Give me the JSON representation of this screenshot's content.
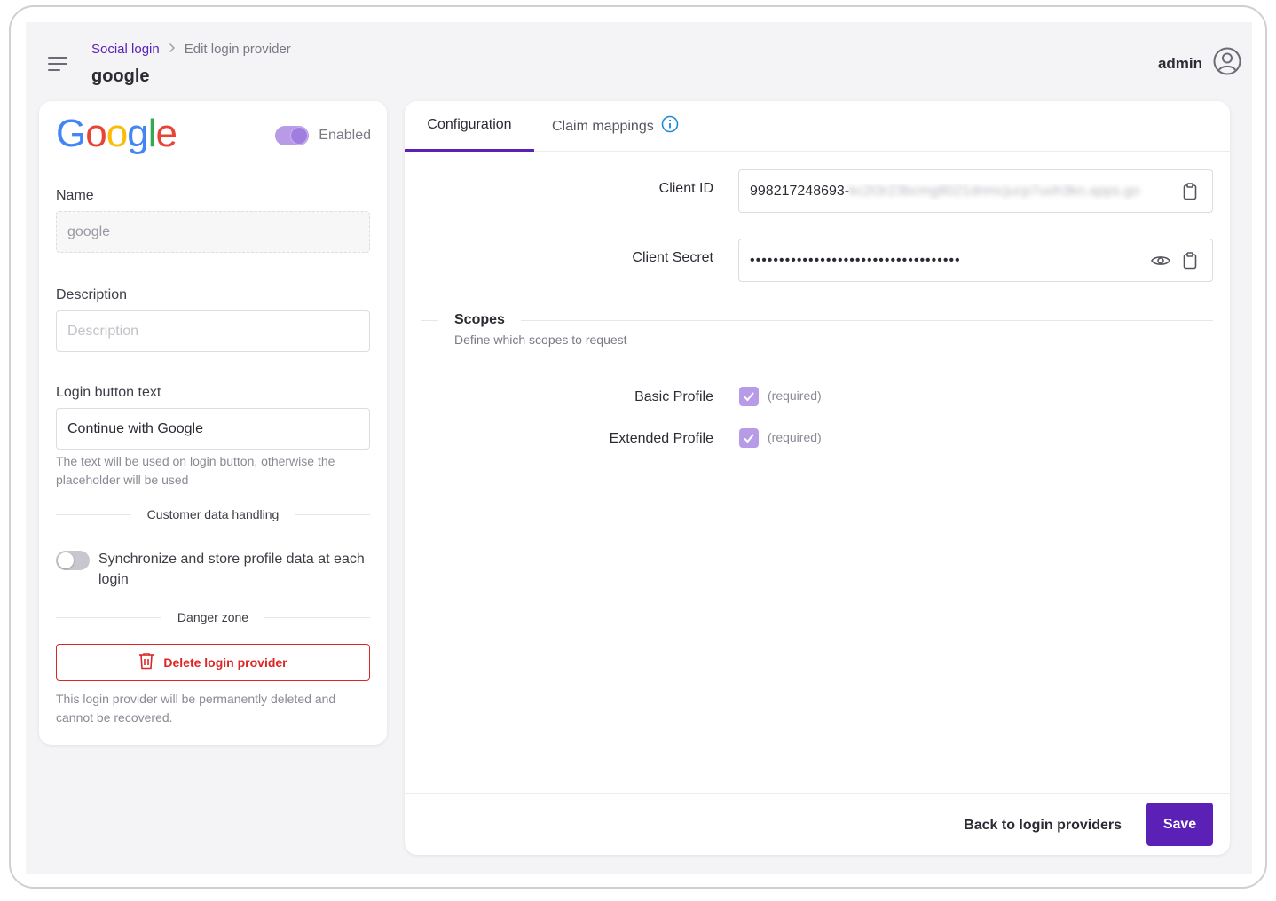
{
  "header": {
    "breadcrumb_link": "Social login",
    "breadcrumb_current": "Edit login provider",
    "page_title": "google",
    "user_name": "admin"
  },
  "provider": {
    "logo_letters": [
      "G",
      "o",
      "o",
      "g",
      "l",
      "e"
    ],
    "enabled_label": "Enabled",
    "enabled": true,
    "name_label": "Name",
    "name_value": "google",
    "description_label": "Description",
    "description_placeholder": "Description",
    "description_value": "",
    "login_button_label": "Login button text",
    "login_button_value": "Continue with Google",
    "login_button_help": "The text will be used on login button, otherwise the placeholder will be used",
    "customer_data_divider": "Customer data handling",
    "sync_label": "Synchronize and store profile data at each login",
    "sync_enabled": false,
    "danger_divider": "Danger zone",
    "delete_button": "Delete login provider",
    "delete_help": "This login provider will be permanently deleted and cannot be recovered."
  },
  "tabs": {
    "configuration": "Configuration",
    "claim_mappings": "Claim mappings"
  },
  "config": {
    "client_id_label": "Client ID",
    "client_id_visible": "998217248693-",
    "client_id_blurred": "kc2t3r23bcmg8021dnmcjucp7uoh3kn.apps.go",
    "client_secret_label": "Client Secret",
    "client_secret_masked": "••••••••••••••••••••••••••••••••••••",
    "scopes_title": "Scopes",
    "scopes_description": "Define which scopes to request",
    "scopes": [
      {
        "label": "Basic Profile",
        "note": "(required)",
        "checked": true
      },
      {
        "label": "Extended Profile",
        "note": "(required)",
        "checked": true
      }
    ]
  },
  "footer": {
    "back_label": "Back to login providers",
    "save_label": "Save"
  },
  "colors": {
    "brand": "#5b21b6",
    "danger": "#dc2626",
    "toggle_on": "#b79be6",
    "info": "#1d8bd6"
  }
}
